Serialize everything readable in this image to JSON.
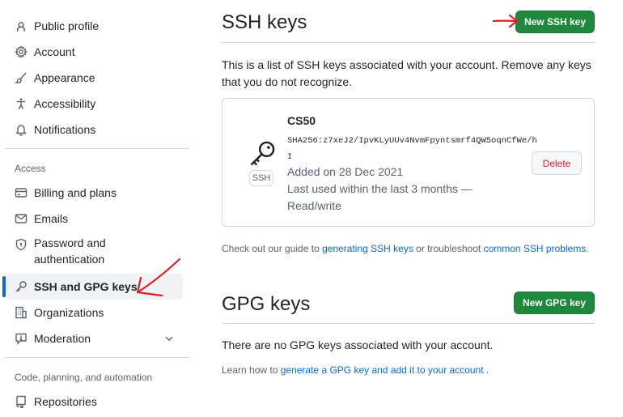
{
  "sidebar": {
    "items": [
      {
        "label": "Public profile",
        "icon": "person-icon"
      },
      {
        "label": "Account",
        "icon": "gear-icon"
      },
      {
        "label": "Appearance",
        "icon": "paintbrush-icon"
      },
      {
        "label": "Accessibility",
        "icon": "accessibility-icon"
      },
      {
        "label": "Notifications",
        "icon": "bell-icon"
      }
    ],
    "access_label": "Access",
    "access_items": [
      {
        "label": "Billing and plans",
        "icon": "credit-card-icon"
      },
      {
        "label": "Emails",
        "icon": "mail-icon"
      },
      {
        "label": "Password and authentication",
        "icon": "shield-lock-icon"
      },
      {
        "label": "SSH and GPG keys",
        "icon": "key-icon"
      },
      {
        "label": "Organizations",
        "icon": "organization-icon"
      },
      {
        "label": "Moderation",
        "icon": "report-icon"
      }
    ],
    "code_label": "Code, planning, and automation",
    "code_items": [
      {
        "label": "Repositories",
        "icon": "repo-icon"
      }
    ]
  },
  "ssh": {
    "title": "SSH keys",
    "new_button": "New SSH key",
    "description": "This is a list of SSH keys associated with your account. Remove any keys that you do not recognize.",
    "key": {
      "name": "CS50",
      "badge": "SSH",
      "fingerprint": "SHA256:z7xeJ2/IpvKLyUUv4NvmFpyntsmrf4QW5oqnCfWe/hI",
      "added": "Added on 28 Dec 2021",
      "last_used": "Last used within the last 3 months —",
      "access": "Read/write",
      "delete_label": "Delete"
    },
    "guide_prefix": "Check out our guide to",
    "guide_link1": "generating SSH keys",
    "guide_mid": "or troubleshoot",
    "guide_link2": "common SSH problems",
    "guide_suffix": "."
  },
  "gpg": {
    "title": "GPG keys",
    "new_button": "New GPG key",
    "empty_text": "There are no GPG keys associated with your account.",
    "learn_prefix": "Learn how to",
    "learn_link": "generate a GPG key and add it to your account",
    "learn_suffix": "."
  },
  "colors": {
    "primary_button": "#1f883d",
    "link": "#0969da",
    "active_indicator": "#0969da",
    "danger": "#d1242f",
    "annotation": "#e02020"
  }
}
